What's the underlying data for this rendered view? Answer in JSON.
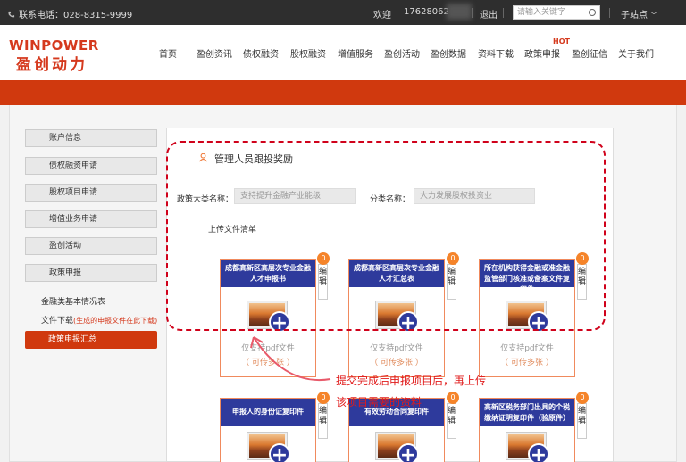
{
  "topbar": {
    "phone": "联系电话：028-8315-9999",
    "welcome": "欢迎",
    "user": "17628062",
    "logout": "退出",
    "search_placeholder": "请输入关键字",
    "substation": "子站点"
  },
  "logo": {
    "en": "WINPOWER",
    "cn": "盈创动力"
  },
  "nav": [
    "首页",
    "盈创资讯",
    "债权融资",
    "股权融资",
    "增值服务",
    "盈创活动",
    "盈创数据",
    "资料下载",
    "政策申报",
    "盈创征信",
    "关于我们"
  ],
  "nav_hot": "HOT",
  "sidebar": {
    "items": [
      "账户信息",
      "债权融资申请",
      "股权项目申请",
      "增值业务申请",
      "盈创活动",
      "政策申报"
    ],
    "sub_basic": "金融类基本情况表",
    "sub_download": "文件下载",
    "sub_download_note": "(生成的申报文件在此下载)",
    "active": "政策申报汇总"
  },
  "panel": {
    "title": "管理人员跟投奖励",
    "category_label": "政策大类名称：",
    "category_value": "支持提升金融产业能级",
    "subcategory_label": "分类名称：",
    "subcategory_value": "大力发展股权投资业",
    "upload_title": "上传文件清单"
  },
  "cards": [
    {
      "title": "成都高新区高层次专业金融人才申报书",
      "badge": "0",
      "edit": "编辑",
      "note": "仅支持pdf文件",
      "multi": "（ 可传多张 ）"
    },
    {
      "title": "成都高新区高层次专业金融人才汇总表",
      "badge": "0",
      "edit": "编辑",
      "note": "仅支持pdf文件",
      "multi": "（ 可传多张 ）"
    },
    {
      "title": "所在机构获得金融或准金融监管部门核准或备案文件复印件",
      "badge": "0",
      "edit": "编辑",
      "note": "仅支持pdf文件",
      "multi": "（ 可传多张 ）"
    },
    {
      "title": "申报人的身份证复印件",
      "badge": "0",
      "edit": "编辑"
    },
    {
      "title": "有效劳动合同复印件",
      "badge": "0",
      "edit": "编辑"
    },
    {
      "title": "高新区税务部门出具的个税缴纳证明复印件（验原件）",
      "badge": "0",
      "edit": "编辑"
    }
  ],
  "annotation": {
    "line1": "提交完成后申报项目后，再上传",
    "line2": "该项目需要的资料"
  },
  "colors": {
    "brand": "#d0390e",
    "card_header": "#2e3a9c",
    "badge": "#f5842a",
    "annotation": "#d0021b"
  }
}
